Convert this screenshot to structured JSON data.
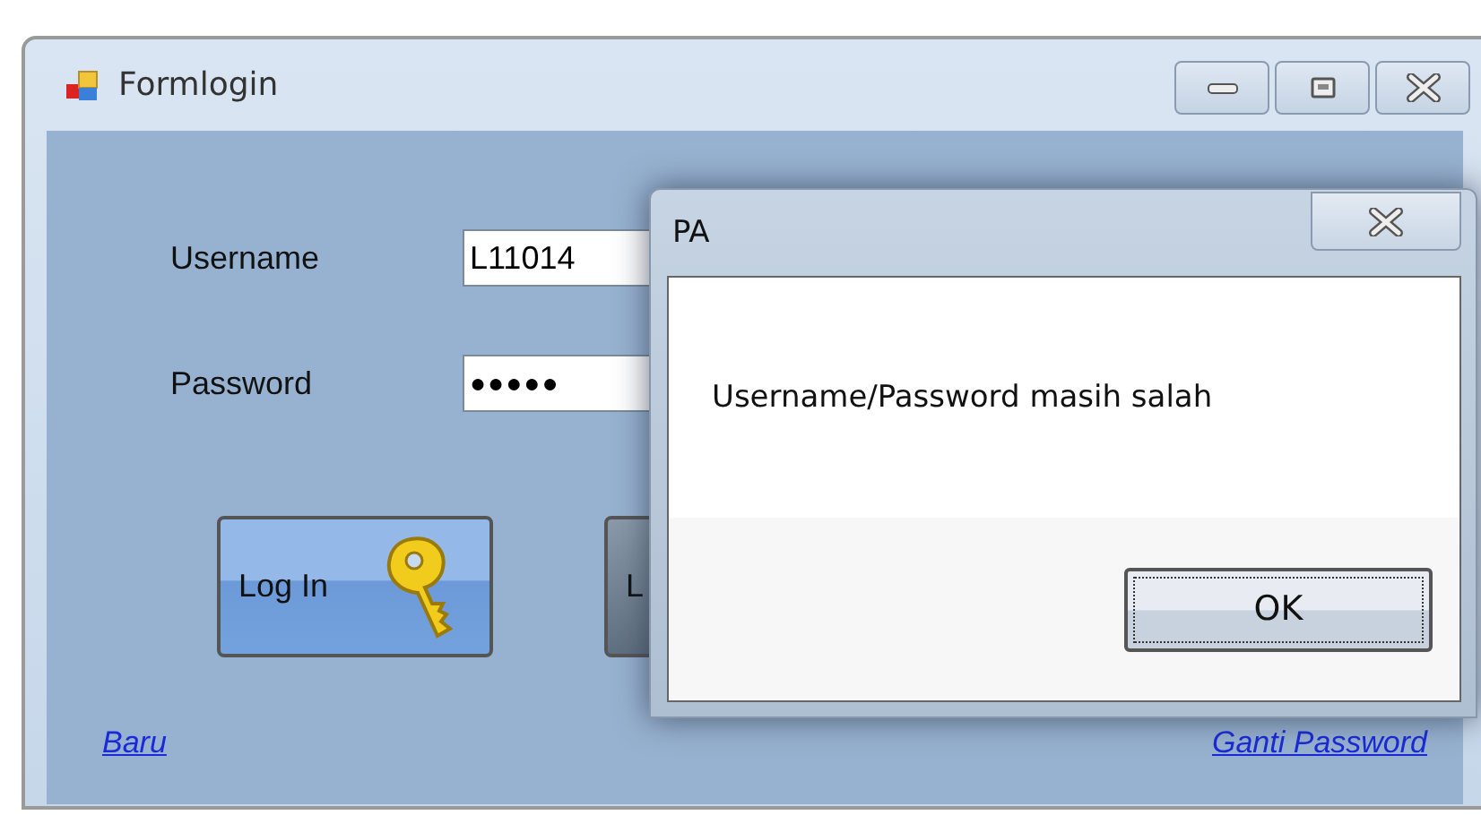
{
  "window": {
    "title": "Formlogin"
  },
  "fields": [
    {
      "label": "Username",
      "value": "L11014",
      "kind": "text"
    },
    {
      "label": "Password",
      "value": "●●●●●",
      "kind": "password"
    }
  ],
  "buttons": [
    {
      "label": "Log In",
      "kind": "key"
    },
    {
      "label": "L",
      "kind": "plain"
    }
  ],
  "links": [
    "Baru",
    "Ganti Password"
  ],
  "dialog": {
    "title": "PA",
    "message": "Username/Password masih salah",
    "button": "OK"
  }
}
